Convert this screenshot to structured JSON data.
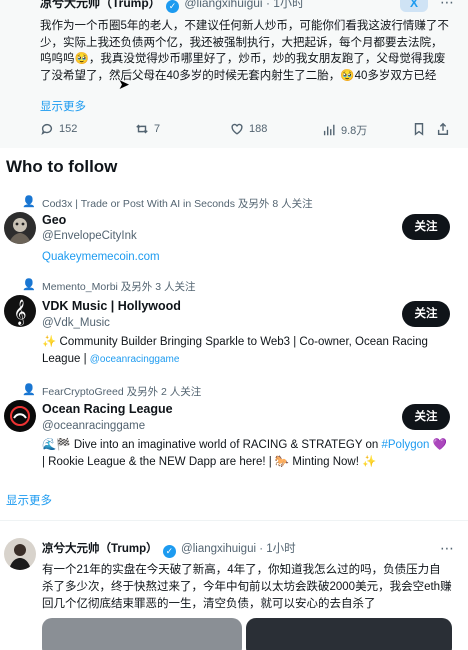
{
  "top_tweet": {
    "author": "凉兮大元帅（Trump）",
    "handle": "@liangxihuigui",
    "time": "· 1小时",
    "grok_label": "X",
    "body": "我作为一个币圈5年的老人，不建议任何新人炒币，可能你们看我这波行情赚了不少，实际上我还负债两个亿，我还被强制执行，大把起诉，每个月都要去法院，呜呜呜🥹，我真没觉得炒币哪里好了，炒币，炒的我女朋友跑了，父母觉得我废了没希望了，然后父母在40多岁的时候无套内射生了二胎，🥹40多岁双方已经",
    "show_more": "显示更多",
    "actions": {
      "replies": "152",
      "retweets": "7",
      "likes": "188",
      "views": "9.8万"
    }
  },
  "who_to_follow": {
    "title": "Who to follow",
    "show_more": "显示更多",
    "follow_label": "关注",
    "accounts": [
      {
        "social": "Cod3x | Trade or Post With AI in Seconds 及另外 8 人关注",
        "name": "Geo",
        "handle": "@EnvelopeCityInk",
        "bio": "Quakeymemecoin.com"
      },
      {
        "social": "Memento_Morbi 及另外 3 人关注",
        "name": "VDK Music | Hollywood",
        "handle": "@Vdk_Music",
        "bio": "✨ Community Builder Bringing Sparkle to Web3 | Co-owner, Ocean Racing League |",
        "bio_link": "@oceanracinggame"
      },
      {
        "social": "FearCryptoGreed 及另外 2 人关注",
        "name": "Ocean Racing League",
        "handle": "@oceanracinggame",
        "bio_a": "🌊🏁 Dive into an imaginative world of RACING & STRATEGY on",
        "bio_link": "#Polygon",
        "bio_b": "💜 | Rookie League & the NEW Dapp are here! | 🐎 Minting Now! ✨"
      }
    ]
  },
  "second_tweet": {
    "author": "凉兮大元帅（Trump）",
    "handle": "@liangxihuigui",
    "time": "· 1小时",
    "body": "有一个21年的实盘在今天破了新高，4年了，你知道我怎么过的吗，负债压力自杀了多少次，终于快熬过来了，今年中旬前以太坊会跌破2000美元，我会空eth赚回几个亿彻底结束罪恶的一生，清空负债，就可以安心的去自杀了"
  }
}
